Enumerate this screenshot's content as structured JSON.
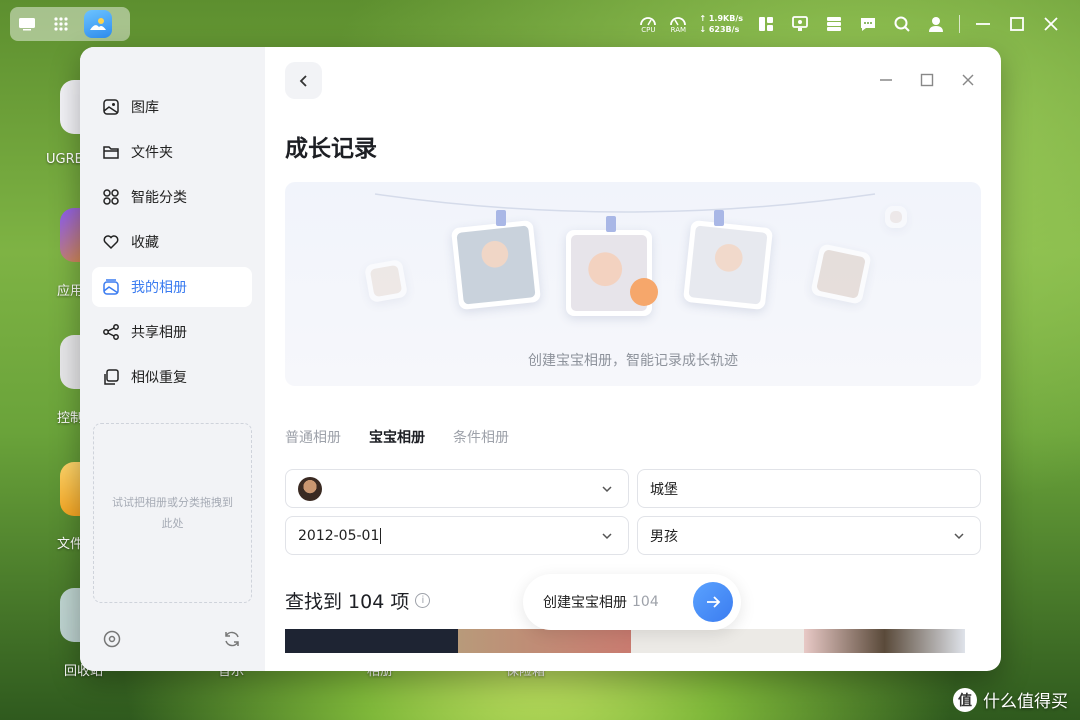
{
  "topbar": {
    "cpu_label": "CPU",
    "ram_label": "RAM",
    "upload": "↑ 1.9KB/s",
    "download": "↓ 623B/s"
  },
  "desktop": {
    "labels": [
      "UGRE",
      "应用",
      "控制",
      "文件",
      "回收站",
      "音乐",
      "相册",
      "保险箱"
    ]
  },
  "sidebar": {
    "items": [
      {
        "label": "图库",
        "icon": "gallery-icon"
      },
      {
        "label": "文件夹",
        "icon": "folder-icon"
      },
      {
        "label": "智能分类",
        "icon": "grid-icon"
      },
      {
        "label": "收藏",
        "icon": "heart-icon"
      },
      {
        "label": "我的相册",
        "icon": "album-icon",
        "active": true
      },
      {
        "label": "共享相册",
        "icon": "share-icon"
      },
      {
        "label": "相似重复",
        "icon": "duplicate-icon"
      }
    ],
    "dropzone_text": "试试把相册或分类拖拽到此处"
  },
  "main": {
    "title": "成长记录",
    "banner_text": "创建宝宝相册，智能记录成长轨迹",
    "tabs": [
      {
        "label": "普通相册",
        "active": false
      },
      {
        "label": "宝宝相册",
        "active": true
      },
      {
        "label": "条件相册",
        "active": false
      }
    ],
    "form": {
      "name_value": "城堡",
      "birthday_value": "2012-05-01",
      "gender_value": "男孩"
    },
    "found_label": "查找到 104 项",
    "create_button_label": "创建宝宝相册",
    "create_button_count": "104"
  },
  "watermark": {
    "logo": "值",
    "text": "什么值得买"
  },
  "colors": {
    "accent": "#3b7cf0",
    "sidebar_bg": "#f2f3f6"
  }
}
